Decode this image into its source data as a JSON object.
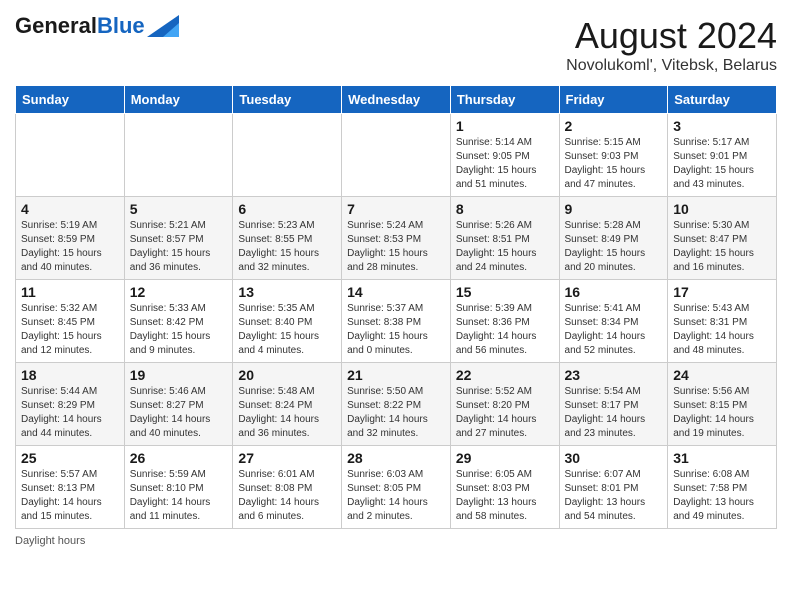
{
  "header": {
    "logo_general": "General",
    "logo_blue": "Blue",
    "month_title": "August 2024",
    "location": "Novolukoml', Vitebsk, Belarus"
  },
  "days_of_week": [
    "Sunday",
    "Monday",
    "Tuesday",
    "Wednesday",
    "Thursday",
    "Friday",
    "Saturday"
  ],
  "weeks": [
    [
      {
        "day": "",
        "info": ""
      },
      {
        "day": "",
        "info": ""
      },
      {
        "day": "",
        "info": ""
      },
      {
        "day": "",
        "info": ""
      },
      {
        "day": "1",
        "info": "Sunrise: 5:14 AM\nSunset: 9:05 PM\nDaylight: 15 hours\nand 51 minutes."
      },
      {
        "day": "2",
        "info": "Sunrise: 5:15 AM\nSunset: 9:03 PM\nDaylight: 15 hours\nand 47 minutes."
      },
      {
        "day": "3",
        "info": "Sunrise: 5:17 AM\nSunset: 9:01 PM\nDaylight: 15 hours\nand 43 minutes."
      }
    ],
    [
      {
        "day": "4",
        "info": "Sunrise: 5:19 AM\nSunset: 8:59 PM\nDaylight: 15 hours\nand 40 minutes."
      },
      {
        "day": "5",
        "info": "Sunrise: 5:21 AM\nSunset: 8:57 PM\nDaylight: 15 hours\nand 36 minutes."
      },
      {
        "day": "6",
        "info": "Sunrise: 5:23 AM\nSunset: 8:55 PM\nDaylight: 15 hours\nand 32 minutes."
      },
      {
        "day": "7",
        "info": "Sunrise: 5:24 AM\nSunset: 8:53 PM\nDaylight: 15 hours\nand 28 minutes."
      },
      {
        "day": "8",
        "info": "Sunrise: 5:26 AM\nSunset: 8:51 PM\nDaylight: 15 hours\nand 24 minutes."
      },
      {
        "day": "9",
        "info": "Sunrise: 5:28 AM\nSunset: 8:49 PM\nDaylight: 15 hours\nand 20 minutes."
      },
      {
        "day": "10",
        "info": "Sunrise: 5:30 AM\nSunset: 8:47 PM\nDaylight: 15 hours\nand 16 minutes."
      }
    ],
    [
      {
        "day": "11",
        "info": "Sunrise: 5:32 AM\nSunset: 8:45 PM\nDaylight: 15 hours\nand 12 minutes."
      },
      {
        "day": "12",
        "info": "Sunrise: 5:33 AM\nSunset: 8:42 PM\nDaylight: 15 hours\nand 9 minutes."
      },
      {
        "day": "13",
        "info": "Sunrise: 5:35 AM\nSunset: 8:40 PM\nDaylight: 15 hours\nand 4 minutes."
      },
      {
        "day": "14",
        "info": "Sunrise: 5:37 AM\nSunset: 8:38 PM\nDaylight: 15 hours\nand 0 minutes."
      },
      {
        "day": "15",
        "info": "Sunrise: 5:39 AM\nSunset: 8:36 PM\nDaylight: 14 hours\nand 56 minutes."
      },
      {
        "day": "16",
        "info": "Sunrise: 5:41 AM\nSunset: 8:34 PM\nDaylight: 14 hours\nand 52 minutes."
      },
      {
        "day": "17",
        "info": "Sunrise: 5:43 AM\nSunset: 8:31 PM\nDaylight: 14 hours\nand 48 minutes."
      }
    ],
    [
      {
        "day": "18",
        "info": "Sunrise: 5:44 AM\nSunset: 8:29 PM\nDaylight: 14 hours\nand 44 minutes."
      },
      {
        "day": "19",
        "info": "Sunrise: 5:46 AM\nSunset: 8:27 PM\nDaylight: 14 hours\nand 40 minutes."
      },
      {
        "day": "20",
        "info": "Sunrise: 5:48 AM\nSunset: 8:24 PM\nDaylight: 14 hours\nand 36 minutes."
      },
      {
        "day": "21",
        "info": "Sunrise: 5:50 AM\nSunset: 8:22 PM\nDaylight: 14 hours\nand 32 minutes."
      },
      {
        "day": "22",
        "info": "Sunrise: 5:52 AM\nSunset: 8:20 PM\nDaylight: 14 hours\nand 27 minutes."
      },
      {
        "day": "23",
        "info": "Sunrise: 5:54 AM\nSunset: 8:17 PM\nDaylight: 14 hours\nand 23 minutes."
      },
      {
        "day": "24",
        "info": "Sunrise: 5:56 AM\nSunset: 8:15 PM\nDaylight: 14 hours\nand 19 minutes."
      }
    ],
    [
      {
        "day": "25",
        "info": "Sunrise: 5:57 AM\nSunset: 8:13 PM\nDaylight: 14 hours\nand 15 minutes."
      },
      {
        "day": "26",
        "info": "Sunrise: 5:59 AM\nSunset: 8:10 PM\nDaylight: 14 hours\nand 11 minutes."
      },
      {
        "day": "27",
        "info": "Sunrise: 6:01 AM\nSunset: 8:08 PM\nDaylight: 14 hours\nand 6 minutes."
      },
      {
        "day": "28",
        "info": "Sunrise: 6:03 AM\nSunset: 8:05 PM\nDaylight: 14 hours\nand 2 minutes."
      },
      {
        "day": "29",
        "info": "Sunrise: 6:05 AM\nSunset: 8:03 PM\nDaylight: 13 hours\nand 58 minutes."
      },
      {
        "day": "30",
        "info": "Sunrise: 6:07 AM\nSunset: 8:01 PM\nDaylight: 13 hours\nand 54 minutes."
      },
      {
        "day": "31",
        "info": "Sunrise: 6:08 AM\nSunset: 7:58 PM\nDaylight: 13 hours\nand 49 minutes."
      }
    ]
  ],
  "footer": {
    "note": "Daylight hours"
  }
}
